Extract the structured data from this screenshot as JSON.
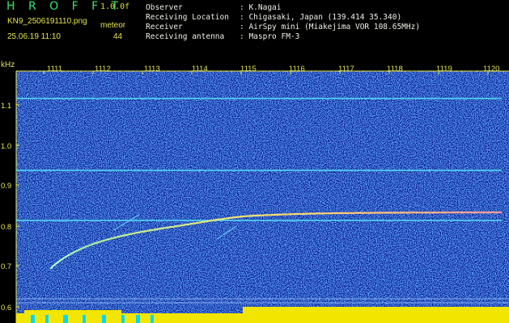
{
  "app": {
    "name": "H R O F F T",
    "version": "1.0.0f",
    "filename": "KN9_2506191110.png",
    "mode": "meteor",
    "timestamp": "25.06.19 11:10",
    "count": "44"
  },
  "info": [
    {
      "label": "Observer",
      "value": ": K.Nagai"
    },
    {
      "label": "Receiving Location",
      "value": ": Chigasaki, Japan (139.414 35.340)"
    },
    {
      "label": "Receiver",
      "value": ": AirSpy mini (Miakejima VOR 108.65MHz)"
    },
    {
      "label": "Receiving antenna",
      "value": ": Maspro FM-3"
    }
  ],
  "axis": {
    "y_unit": "kHz",
    "x_ticks": [
      "1111",
      "1112",
      "1113",
      "1114",
      "1115",
      "1116",
      "1117",
      "1118",
      "1119",
      "1120"
    ],
    "y_ticks": [
      "1.1",
      "1.0",
      "0.9",
      "0.8",
      "0.7",
      "0.6"
    ]
  },
  "colors": {
    "background": "#000000",
    "noise_floor": "#0a1a8c",
    "carrier_line": "#55e0ff",
    "meteor_echo": "#ffe066",
    "signal_bar": "#f2e600",
    "cyan_bar": "#00d8ff"
  }
}
